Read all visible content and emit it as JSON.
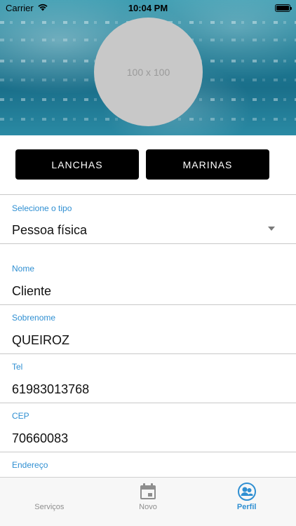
{
  "status_bar": {
    "carrier": "Carrier",
    "time": "10:04 PM"
  },
  "profile": {
    "avatar_placeholder": "100 x 100"
  },
  "buttons": {
    "lanchas": "LANCHAS",
    "marinas": "MARINAS"
  },
  "form": {
    "tipo": {
      "label": "Selecione o tipo",
      "value": "Pessoa física"
    },
    "nome": {
      "label": "Nome",
      "value": "Cliente"
    },
    "sobrenome": {
      "label": "Sobrenome",
      "value": "QUEIROZ"
    },
    "tel": {
      "label": "Tel",
      "value": "61983013768"
    },
    "cep": {
      "label": "CEP",
      "value": "70660083"
    },
    "endereco": {
      "label": "Endereço",
      "value": ""
    }
  },
  "tabbar": {
    "tabs": [
      {
        "label": "Serviços",
        "icon": "services-icon",
        "active": false
      },
      {
        "label": "Novo",
        "icon": "calendar-icon",
        "active": false
      },
      {
        "label": "Perfil",
        "icon": "profile-icon",
        "active": true
      }
    ]
  },
  "colors": {
    "accent": "#2f8fd2",
    "button_bg": "#000000",
    "avatar_bg": "#c8c8c8"
  }
}
